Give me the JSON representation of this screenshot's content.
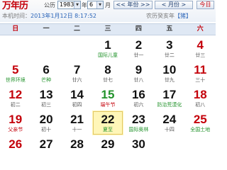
{
  "header": {
    "logo": "万年历",
    "calendar_type_label": "公历",
    "year_select": {
      "value": "1983"
    },
    "year_unit": "年",
    "month_select": {
      "value": "6"
    },
    "month_unit": "月",
    "prev_year_button": "<< 年份 >>",
    "prev_month_button": "< 月份 >",
    "today_button": "今日",
    "clock_label": "本机时间：",
    "clock_value": "2013年1月12日 8:17:52",
    "lunar_year_label": "农历癸亥年",
    "zodiac_label": "【猪】"
  },
  "weekdays": [
    "日",
    "一",
    "二",
    "三",
    "四",
    "五",
    "六"
  ],
  "days": [
    {
      "num": "",
      "sub": "",
      "style": "empty"
    },
    {
      "num": "",
      "sub": "",
      "style": ""
    },
    {
      "num": "",
      "sub": "",
      "style": ""
    },
    {
      "num": "1",
      "sub": "国际儿童",
      "style": "fest"
    },
    {
      "num": "2",
      "sub": "廿一",
      "style": ""
    },
    {
      "num": "3",
      "sub": "廿二",
      "style": ""
    },
    {
      "num": "4",
      "sub": "廿三",
      "style": "weekend"
    },
    {
      "num": "5",
      "sub": "世界环境",
      "style": "weekend fest"
    },
    {
      "num": "6",
      "sub": "芒种",
      "style": "fest"
    },
    {
      "num": "7",
      "sub": "廿六",
      "style": ""
    },
    {
      "num": "8",
      "sub": "廿七",
      "style": ""
    },
    {
      "num": "9",
      "sub": "廿八",
      "style": ""
    },
    {
      "num": "10",
      "sub": "廿九",
      "style": ""
    },
    {
      "num": "11",
      "sub": "三十",
      "style": "weekend"
    },
    {
      "num": "12",
      "sub": "初二",
      "style": "weekend"
    },
    {
      "num": "13",
      "sub": "初三",
      "style": ""
    },
    {
      "num": "14",
      "sub": "初四",
      "style": ""
    },
    {
      "num": "15",
      "sub": "端午节",
      "style": "green hol"
    },
    {
      "num": "16",
      "sub": "初六",
      "style": ""
    },
    {
      "num": "17",
      "sub": "防治荒漠化",
      "style": "fest"
    },
    {
      "num": "18",
      "sub": "初八",
      "style": "weekend"
    },
    {
      "num": "19",
      "sub": "父亲节",
      "style": "weekend hol"
    },
    {
      "num": "20",
      "sub": "初十",
      "style": ""
    },
    {
      "num": "21",
      "sub": "十一",
      "style": ""
    },
    {
      "num": "22",
      "sub": "夏至",
      "style": "today fest"
    },
    {
      "num": "23",
      "sub": "国际奥林",
      "style": "fest"
    },
    {
      "num": "24",
      "sub": "十四",
      "style": ""
    },
    {
      "num": "25",
      "sub": "全国土地",
      "style": "weekend fest"
    },
    {
      "num": "26",
      "sub": "",
      "style": "weekend"
    },
    {
      "num": "27",
      "sub": "",
      "style": ""
    },
    {
      "num": "28",
      "sub": "",
      "style": ""
    },
    {
      "num": "29",
      "sub": "",
      "style": ""
    },
    {
      "num": "30",
      "sub": "",
      "style": ""
    },
    {
      "num": "",
      "sub": "",
      "style": ""
    },
    {
      "num": "",
      "sub": "",
      "style": "weekend"
    }
  ]
}
